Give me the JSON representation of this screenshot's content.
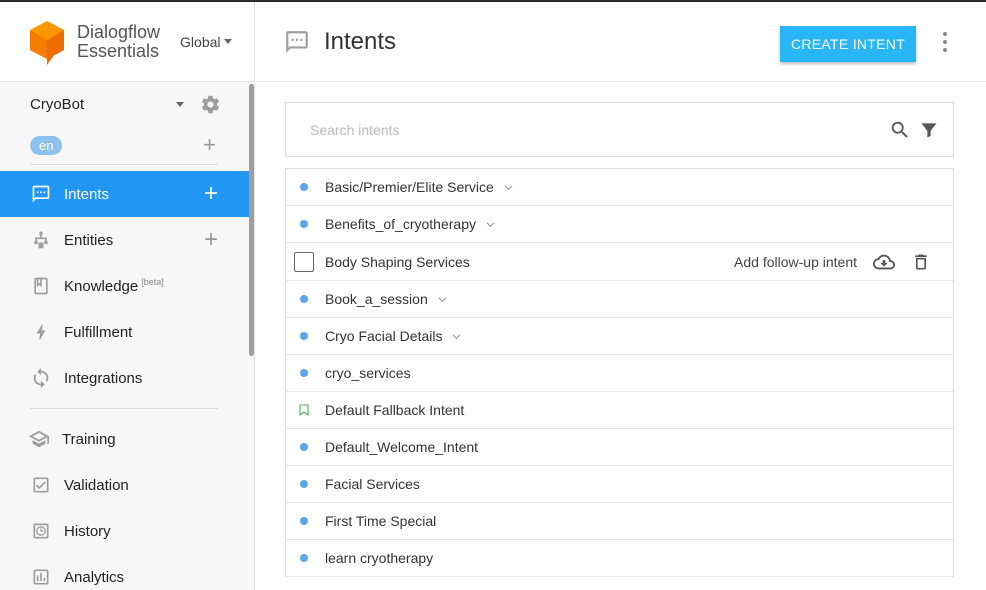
{
  "brand": {
    "name_line1": "Dialogflow",
    "name_line2": "Essentials",
    "region": "Global",
    "logo_color": "#f57c00"
  },
  "agent": {
    "name": "CryoBot",
    "language": "en"
  },
  "sidebar": {
    "items": [
      {
        "label": "Intents",
        "icon": "chat-icon",
        "active": true,
        "has_add": true
      },
      {
        "label": "Entities",
        "icon": "hierarchy-icon",
        "active": false,
        "has_add": true
      },
      {
        "label": "Knowledge",
        "badge": "[beta]",
        "icon": "book-icon",
        "active": false,
        "has_add": false
      },
      {
        "label": "Fulfillment",
        "icon": "bolt-icon",
        "active": false,
        "has_add": false
      },
      {
        "label": "Integrations",
        "icon": "sync-icon",
        "active": false,
        "has_add": false
      },
      {
        "label": "Training",
        "icon": "graduation-cap-icon",
        "active": false,
        "has_add": false
      },
      {
        "label": "Validation",
        "icon": "check-square-icon",
        "active": false,
        "has_add": false
      },
      {
        "label": "History",
        "icon": "clock-icon",
        "active": false,
        "has_add": false
      },
      {
        "label": "Analytics",
        "icon": "bar-chart-icon",
        "active": false,
        "has_add": false
      }
    ]
  },
  "header": {
    "title": "Intents",
    "create_button": "CREATE INTENT"
  },
  "search": {
    "placeholder": "Search intents",
    "value": ""
  },
  "intents": [
    {
      "name": "Basic/Premier/Elite Service",
      "marker": "dot",
      "expandable": true
    },
    {
      "name": "Benefits_of_cryotherapy",
      "marker": "dot",
      "expandable": true
    },
    {
      "name": "Body Shaping Services",
      "marker": "checkbox",
      "expandable": false,
      "hovered": true,
      "followup_label": "Add follow-up intent"
    },
    {
      "name": "Book_a_session",
      "marker": "dot",
      "expandable": true
    },
    {
      "name": "Cryo Facial Details",
      "marker": "dot",
      "expandable": true
    },
    {
      "name": "cryo_services",
      "marker": "dot",
      "expandable": false
    },
    {
      "name": "Default Fallback Intent",
      "marker": "bookmark",
      "expandable": false
    },
    {
      "name": "Default_Welcome_Intent",
      "marker": "dot",
      "expandable": false
    },
    {
      "name": "Facial Services",
      "marker": "dot",
      "expandable": false
    },
    {
      "name": "First Time Special",
      "marker": "dot",
      "expandable": false
    },
    {
      "name": "learn cryotherapy",
      "marker": "dot",
      "expandable": false
    }
  ],
  "colors": {
    "accent": "#2196f3",
    "create_button": "#29b6f6",
    "intent_dot": "#5aa7e8",
    "fallback_bookmark": "#4caf50"
  }
}
